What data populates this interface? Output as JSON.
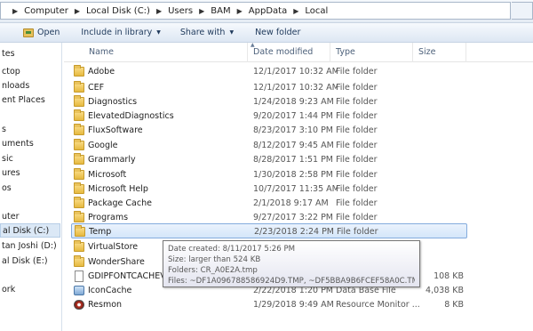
{
  "breadcrumb": [
    "Computer",
    "Local Disk (C:)",
    "Users",
    "BAM",
    "AppData",
    "Local"
  ],
  "toolbar": {
    "open": "Open",
    "include_in_library": "Include in library",
    "share_with": "Share with",
    "new_folder": "New folder"
  },
  "nav": {
    "items": [
      "tes",
      "ctop",
      "nloads",
      "ent Places",
      "",
      "s",
      "uments",
      "sic",
      "ures",
      "os",
      "",
      "uter",
      "al Disk (C:)",
      "tan Joshi (D:)",
      "al Disk (E:)",
      "",
      "ork"
    ],
    "selected_label": "al Disk (C:)"
  },
  "columns": {
    "name": "Name",
    "date_modified": "Date modified",
    "type": "Type",
    "size": "Size"
  },
  "files": [
    {
      "name": "Adobe",
      "date": "12/1/2017 10:32 AM",
      "type": "File folder",
      "size": "",
      "icon": "folder-icon"
    },
    {
      "name": "CEF",
      "date": "12/1/2017 10:32 AM",
      "type": "File folder",
      "size": "",
      "icon": "folder-icon"
    },
    {
      "name": "Diagnostics",
      "date": "1/24/2018 9:23 AM",
      "type": "File folder",
      "size": "",
      "icon": "folder-icon"
    },
    {
      "name": "ElevatedDiagnostics",
      "date": "9/20/2017 1:44 PM",
      "type": "File folder",
      "size": "",
      "icon": "folder-icon"
    },
    {
      "name": "FluxSoftware",
      "date": "8/23/2017 3:10 PM",
      "type": "File folder",
      "size": "",
      "icon": "folder-icon"
    },
    {
      "name": "Google",
      "date": "8/12/2017 9:45 AM",
      "type": "File folder",
      "size": "",
      "icon": "folder-icon"
    },
    {
      "name": "Grammarly",
      "date": "8/28/2017 1:51 PM",
      "type": "File folder",
      "size": "",
      "icon": "folder-icon"
    },
    {
      "name": "Microsoft",
      "date": "1/30/2018 2:58 PM",
      "type": "File folder",
      "size": "",
      "icon": "folder-icon"
    },
    {
      "name": "Microsoft Help",
      "date": "10/7/2017 11:35 AM",
      "type": "File folder",
      "size": "",
      "icon": "folder-icon"
    },
    {
      "name": "Package Cache",
      "date": "2/1/2018 9:17 AM",
      "type": "File folder",
      "size": "",
      "icon": "folder-icon"
    },
    {
      "name": "Programs",
      "date": "9/27/2017 3:22 PM",
      "type": "File folder",
      "size": "",
      "icon": "folder-icon"
    },
    {
      "name": "Temp",
      "date": "2/23/2018 2:24 PM",
      "type": "File folder",
      "size": "",
      "icon": "folder-icon"
    },
    {
      "name": "VirtualStore",
      "date": "",
      "type": "",
      "size": "",
      "icon": "folder-icon"
    },
    {
      "name": "WonderShare",
      "date": "",
      "type": "",
      "size": "",
      "icon": "folder-icon"
    },
    {
      "name": "GDIPFONTCACHEV1",
      "date": "",
      "type": "",
      "size": "108 KB",
      "icon": "file-icon"
    },
    {
      "name": "IconCache",
      "date": "2/22/2018 1:20 PM",
      "type": "Data Base File",
      "size": "4,038 KB",
      "icon": "cache-icon"
    },
    {
      "name": "Resmon",
      "date": "1/29/2018 9:49 AM",
      "type": "Resource Monitor ...",
      "size": "8 KB",
      "icon": "resmon-icon"
    }
  ],
  "selected_file": "Temp",
  "tooltip": {
    "date_created": "Date created: 8/11/2017 5:26 PM",
    "size": "Size: larger than 524 KB",
    "folders": "Folders: CR_A0E2A.tmp",
    "files": "Files: ~DF1A096788586924D9.TMP, ~DF5BBA9B6FCEF58A0C.TMP, ..."
  }
}
